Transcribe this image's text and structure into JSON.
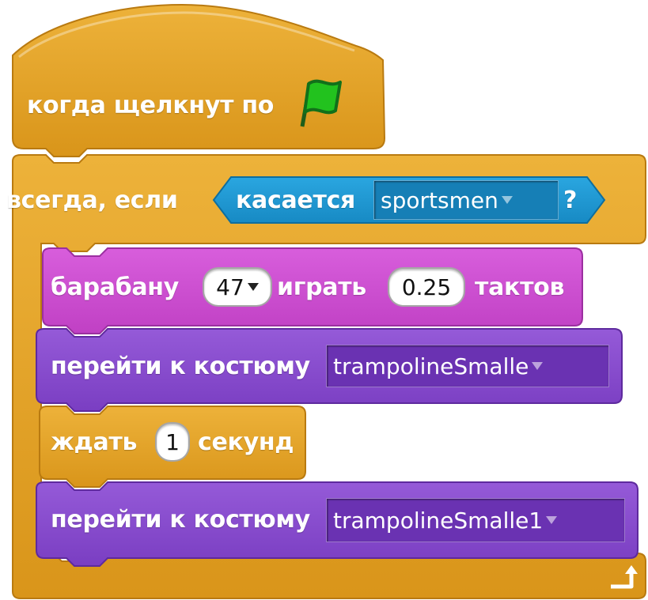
{
  "script": {
    "hat_block": {
      "label": "когда щелкнут по",
      "icon": "green-flag-icon",
      "color": "#E6A522"
    },
    "forever_if_block": {
      "label": "всегда, если",
      "color": "#E6A522",
      "condition": {
        "label": "касается",
        "object": "sportsmen",
        "suffix": "?",
        "color": "#1E9BD6"
      },
      "loop_icon": "loop-arrow-icon"
    },
    "drum_block": {
      "label": "барабану",
      "drum": "47",
      "play_label": "играть",
      "beats": "0.25",
      "beats_label": "тактов",
      "color": "#CE4BD2"
    },
    "costume_block_1": {
      "label": "перейти к костюму",
      "costume": "trampolineSmalle",
      "color": "#8A4BCF"
    },
    "wait_block": {
      "label": "ждать",
      "seconds": "1",
      "seconds_label": "секунд",
      "color": "#E6A522"
    },
    "costume_block_2": {
      "label": "перейти к костюму",
      "costume": "trampolineSmalle1",
      "color": "#8A4BCF"
    }
  }
}
